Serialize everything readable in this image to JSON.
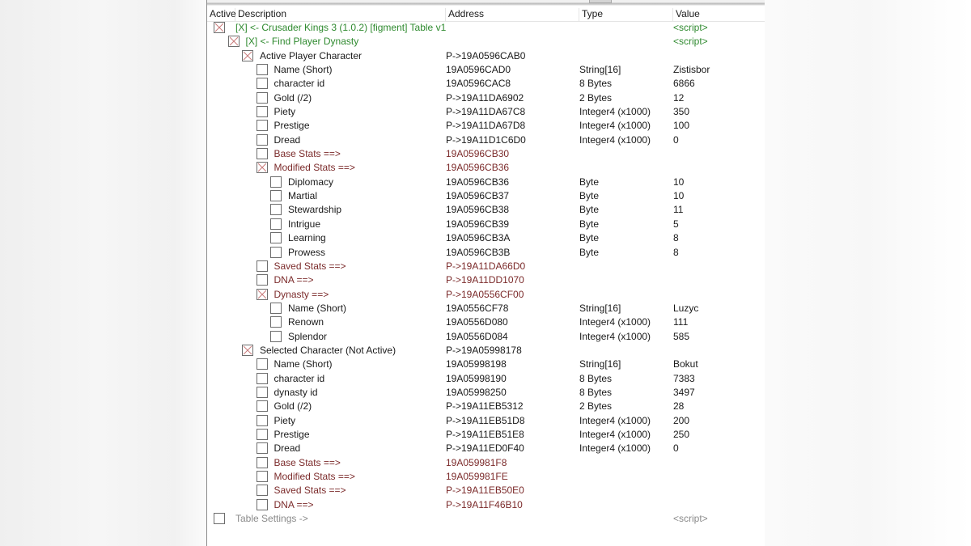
{
  "colors": {
    "script_green": "#2f8a2f",
    "pointer_maroon": "#7b2a2a",
    "settings_gray": "#8a8a8a",
    "check_mark": "#c87a7a"
  },
  "header": {
    "active": "Active",
    "description": "Description",
    "address": "Address",
    "type": "Type",
    "value": "Value"
  },
  "rows": [
    {
      "level": 0,
      "checked": true,
      "style": "green",
      "description": "[X] <- Crusader Kings 3 (1.0.2) [figment] Table v1",
      "address": "",
      "type": "",
      "value": "<script>"
    },
    {
      "level": 1,
      "checked": true,
      "style": "green",
      "description": "[X] <- Find Player Dynasty",
      "address": "",
      "type": "",
      "value": "<script>"
    },
    {
      "level": 2,
      "checked": true,
      "style": "normal",
      "description": "Active Player Character",
      "address": "P->19A0596CAB0",
      "type": "",
      "value": ""
    },
    {
      "level": 3,
      "checked": false,
      "style": "normal",
      "description": "Name (Short)",
      "address": "19A0596CAD0",
      "type": "String[16]",
      "value": "Zistisbor"
    },
    {
      "level": 3,
      "checked": false,
      "style": "normal",
      "description": "character id",
      "address": "19A0596CAC8",
      "type": "8 Bytes",
      "value": "6866"
    },
    {
      "level": 3,
      "checked": false,
      "style": "normal",
      "description": "Gold (/2)",
      "address": "P->19A11DA6902",
      "type": "2 Bytes",
      "value": "12"
    },
    {
      "level": 3,
      "checked": false,
      "style": "normal",
      "description": "Piety",
      "address": "P->19A11DA67C8",
      "type": "Integer4 (x1000)",
      "value": "350"
    },
    {
      "level": 3,
      "checked": false,
      "style": "normal",
      "description": "Prestige",
      "address": "P->19A11DA67D8",
      "type": "Integer4 (x1000)",
      "value": "100"
    },
    {
      "level": 3,
      "checked": false,
      "style": "normal",
      "description": "Dread",
      "address": "P->19A11D1C6D0",
      "type": "Integer4 (x1000)",
      "value": "0"
    },
    {
      "level": 3,
      "checked": false,
      "style": "maroon",
      "description": "Base Stats ==>",
      "address": "19A0596CB30",
      "type": "",
      "value": ""
    },
    {
      "level": 3,
      "checked": true,
      "style": "maroon",
      "description": "Modified Stats ==>",
      "address": "19A0596CB36",
      "type": "",
      "value": ""
    },
    {
      "level": 4,
      "checked": false,
      "style": "normal",
      "description": "Diplomacy",
      "address": "19A0596CB36",
      "type": "Byte",
      "value": "10"
    },
    {
      "level": 4,
      "checked": false,
      "style": "normal",
      "description": "Martial",
      "address": "19A0596CB37",
      "type": "Byte",
      "value": "10"
    },
    {
      "level": 4,
      "checked": false,
      "style": "normal",
      "description": "Stewardship",
      "address": "19A0596CB38",
      "type": "Byte",
      "value": "11"
    },
    {
      "level": 4,
      "checked": false,
      "style": "normal",
      "description": "Intrigue",
      "address": "19A0596CB39",
      "type": "Byte",
      "value": "5"
    },
    {
      "level": 4,
      "checked": false,
      "style": "normal",
      "description": "Learning",
      "address": "19A0596CB3A",
      "type": "Byte",
      "value": "8"
    },
    {
      "level": 4,
      "checked": false,
      "style": "normal",
      "description": "Prowess",
      "address": "19A0596CB3B",
      "type": "Byte",
      "value": "8"
    },
    {
      "level": 3,
      "checked": false,
      "style": "maroon",
      "description": "Saved Stats ==>",
      "address": "P->19A11DA66D0",
      "type": "",
      "value": ""
    },
    {
      "level": 3,
      "checked": false,
      "style": "maroon",
      "description": "DNA ==>",
      "address": "P->19A11DD1070",
      "type": "",
      "value": ""
    },
    {
      "level": 3,
      "checked": true,
      "style": "maroon",
      "description": "Dynasty ==>",
      "address": "P->19A0556CF00",
      "type": "",
      "value": ""
    },
    {
      "level": 4,
      "checked": false,
      "style": "normal",
      "description": "Name (Short)",
      "address": "19A0556CF78",
      "type": "String[16]",
      "value": "Luzyc"
    },
    {
      "level": 4,
      "checked": false,
      "style": "normal",
      "description": "Renown",
      "address": "19A0556D080",
      "type": "Integer4 (x1000)",
      "value": "111"
    },
    {
      "level": 4,
      "checked": false,
      "style": "normal",
      "description": "Splendor",
      "address": "19A0556D084",
      "type": "Integer4 (x1000)",
      "value": "585"
    },
    {
      "level": 2,
      "checked": true,
      "style": "normal",
      "description": "Selected Character (Not Active)",
      "address": "P->19A05998178",
      "type": "",
      "value": ""
    },
    {
      "level": 3,
      "checked": false,
      "style": "normal",
      "description": "Name (Short)",
      "address": "19A05998198",
      "type": "String[16]",
      "value": "Bokut"
    },
    {
      "level": 3,
      "checked": false,
      "style": "normal",
      "description": "character id",
      "address": "19A05998190",
      "type": "8 Bytes",
      "value": "7383"
    },
    {
      "level": 3,
      "checked": false,
      "style": "normal",
      "description": "dynasty id",
      "address": "19A05998250",
      "type": "8 Bytes",
      "value": "3497"
    },
    {
      "level": 3,
      "checked": false,
      "style": "normal",
      "description": "Gold (/2)",
      "address": "P->19A11EB5312",
      "type": "2 Bytes",
      "value": "28"
    },
    {
      "level": 3,
      "checked": false,
      "style": "normal",
      "description": "Piety",
      "address": "P->19A11EB51D8",
      "type": "Integer4 (x1000)",
      "value": "200"
    },
    {
      "level": 3,
      "checked": false,
      "style": "normal",
      "description": "Prestige",
      "address": "P->19A11EB51E8",
      "type": "Integer4 (x1000)",
      "value": "250"
    },
    {
      "level": 3,
      "checked": false,
      "style": "normal",
      "description": "Dread",
      "address": "P->19A11ED0F40",
      "type": "Integer4 (x1000)",
      "value": "0"
    },
    {
      "level": 3,
      "checked": false,
      "style": "maroon",
      "description": "Base Stats ==>",
      "address": "19A059981F8",
      "type": "",
      "value": ""
    },
    {
      "level": 3,
      "checked": false,
      "style": "maroon",
      "description": "Modified Stats ==>",
      "address": "19A059981FE",
      "type": "",
      "value": ""
    },
    {
      "level": 3,
      "checked": false,
      "style": "maroon",
      "description": "Saved Stats ==>",
      "address": "P->19A11EB50E0",
      "type": "",
      "value": ""
    },
    {
      "level": 3,
      "checked": false,
      "style": "maroon",
      "description": "DNA ==>",
      "address": "P->19A11F46B10",
      "type": "",
      "value": ""
    },
    {
      "level": 0,
      "checked": false,
      "style": "gray",
      "description": "Table Settings ->",
      "address": "",
      "type": "",
      "value": "<script>"
    }
  ]
}
